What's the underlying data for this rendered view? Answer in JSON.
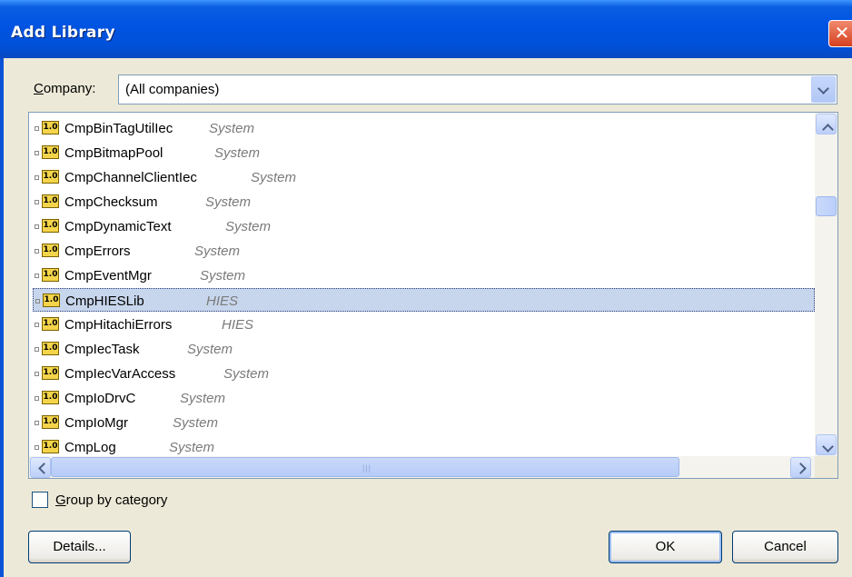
{
  "window": {
    "title": "Add Library",
    "close_glyph": "✕"
  },
  "company": {
    "label_hotkey": "C",
    "label_rest": "ompany:",
    "value": "(All companies)"
  },
  "libraries": [
    {
      "name": "CmpBinTagUtilIec",
      "company": "System",
      "version": "1.0",
      "selected": false
    },
    {
      "name": "CmpBitmapPool",
      "company": "System",
      "version": "1.0",
      "selected": false
    },
    {
      "name": "CmpChannelClientIec",
      "company": "System",
      "version": "1.0",
      "selected": false
    },
    {
      "name": "CmpChecksum",
      "company": "System",
      "version": "1.0",
      "selected": false
    },
    {
      "name": "CmpDynamicText",
      "company": "System",
      "version": "1.0",
      "selected": false
    },
    {
      "name": "CmpErrors",
      "company": "System",
      "version": "1.0",
      "selected": false
    },
    {
      "name": "CmpEventMgr",
      "company": "System",
      "version": "1.0",
      "selected": false
    },
    {
      "name": "CmpHIESLib",
      "company": "HIES",
      "version": "1.0",
      "selected": true
    },
    {
      "name": "CmpHitachiErrors",
      "company": "HIES",
      "version": "1.0",
      "selected": false
    },
    {
      "name": "CmpIecTask",
      "company": "System",
      "version": "1.0",
      "selected": false
    },
    {
      "name": "CmpIecVarAccess",
      "company": "System",
      "version": "1.0",
      "selected": false
    },
    {
      "name": "CmpIoDrvC",
      "company": "System",
      "version": "1.0",
      "selected": false
    },
    {
      "name": "CmpIoMgr",
      "company": "System",
      "version": "1.0",
      "selected": false
    },
    {
      "name": "CmpLog",
      "company": "System",
      "version": "1.0",
      "selected": false
    }
  ],
  "group_by": {
    "hotkey": "G",
    "rest": "roup by category",
    "checked": false
  },
  "buttons": {
    "details": "Details...",
    "ok": "OK",
    "cancel": "Cancel"
  },
  "scrollbar": {
    "grip": "|||"
  },
  "icons": {
    "lib": "library-version-icon",
    "expand": "expand-icon",
    "colors": {
      "lib_fill": "#f4d44a",
      "selection": "#c7d6ec"
    }
  }
}
